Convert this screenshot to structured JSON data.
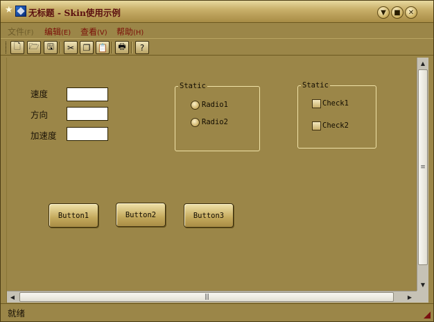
{
  "window": {
    "title": "无标题 - Skin使用示例"
  },
  "menu": [
    {
      "label": "文件",
      "accel": "(F)",
      "disabled": true
    },
    {
      "label": "编辑",
      "accel": "(E)",
      "disabled": false
    },
    {
      "label": "查看",
      "accel": "(V)",
      "disabled": false
    },
    {
      "label": "帮助",
      "accel": "(H)",
      "disabled": false
    }
  ],
  "toolbar": {
    "buttons": [
      "new-document-icon",
      "open-folder-icon",
      "save-icon",
      "cut-icon",
      "copy-icon",
      "paste-icon",
      "print-icon",
      "help-icon"
    ]
  },
  "form": {
    "speed_label": "速度",
    "direction_label": "方向",
    "accel_label": "加速度",
    "speed_value": "",
    "direction_value": "",
    "accel_value": ""
  },
  "radio_group": {
    "title": "Static",
    "options": [
      "Radio1",
      "Radio2"
    ]
  },
  "check_group": {
    "title": "Static",
    "options": [
      "Check1",
      "Check2"
    ]
  },
  "buttons": [
    "Button1",
    "Button2",
    "Button3"
  ],
  "status": {
    "text": "就绪"
  },
  "colors": {
    "background": "#9b8648",
    "menu_text": "#7a0e08",
    "title_text": "#5a0e0e"
  }
}
